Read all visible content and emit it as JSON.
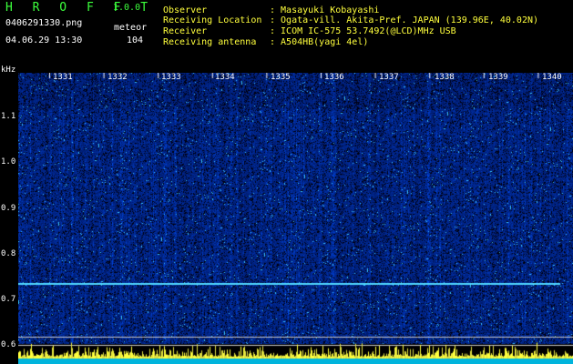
{
  "header": {
    "app_title": "H R O F F T",
    "version": "1.0.0",
    "filename": "0406291330.png",
    "mode": "meteor",
    "datetime": "04.06.29 13:30",
    "count": "104"
  },
  "info": [
    {
      "label": "Observer",
      "value": ": Masayuki Kobayashi"
    },
    {
      "label": "Receiving Location",
      "value": ": Ogata-vill. Akita-Pref. JAPAN (139.96E, 40.02N)"
    },
    {
      "label": "Receiver",
      "value": ": ICOM IC-575 53.7492(@LCD)MHz USB"
    },
    {
      "label": "Receiving antenna",
      "value": ": A504HB(yagi 4el)"
    }
  ],
  "axis": {
    "unit": "kHz",
    "y_ticks": [
      "1.1",
      "1.0",
      "0.9",
      "0.8",
      "0.7",
      "0.6"
    ],
    "time_ticks": [
      "1331",
      "1332",
      "1333",
      "1334",
      "1335",
      "1336",
      "1337",
      "1338",
      "1339",
      "1340"
    ]
  },
  "colors": {
    "background": "#000000",
    "label_green": "#3cff3c",
    "label_yellow": "#ffff3c",
    "spectrum_blue": "#1030c8",
    "carrier_cyan": "#50d8ff"
  }
}
